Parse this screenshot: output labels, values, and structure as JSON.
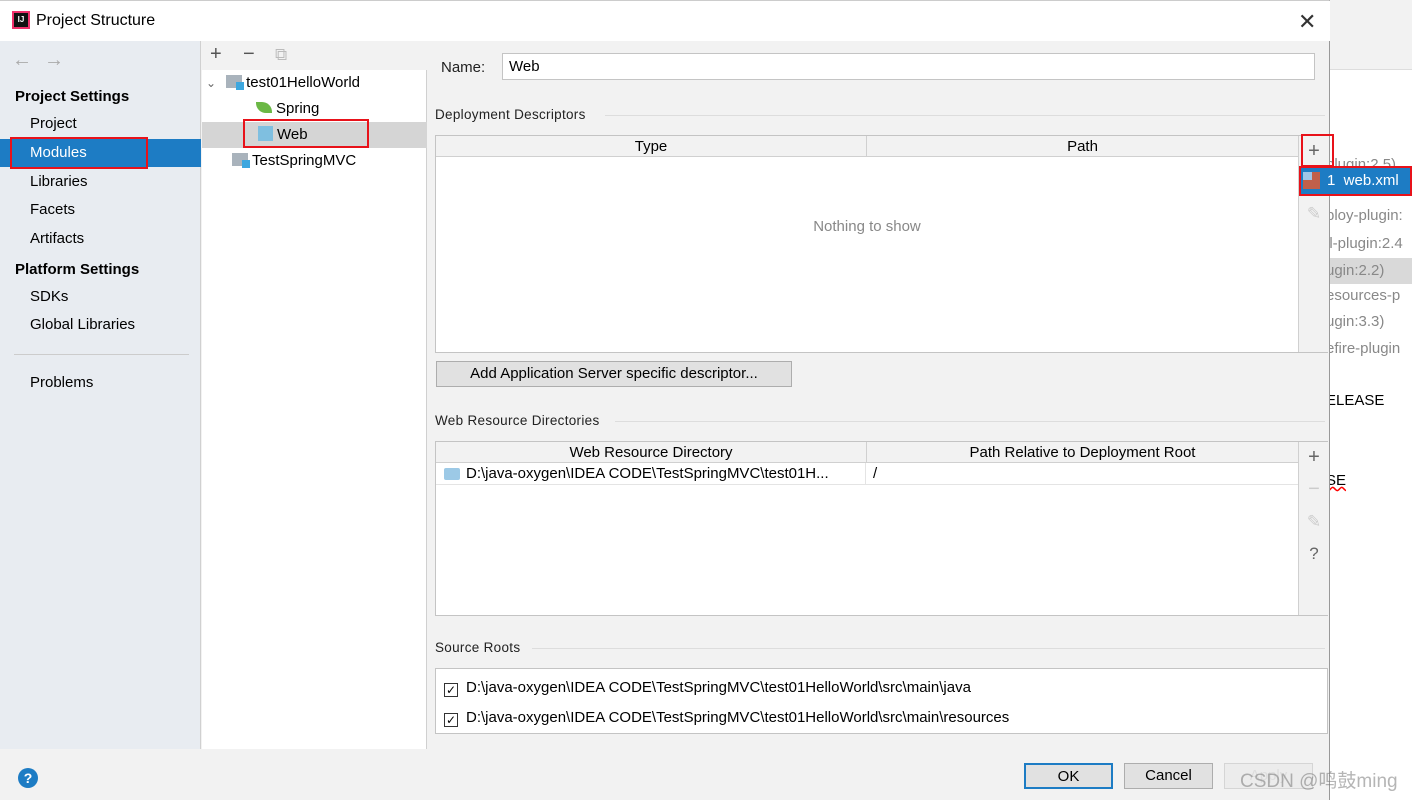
{
  "background_fragments": [
    "plugin:2.5)",
    "ploy-plugin:",
    "ll-plugin:2.4",
    "ugin:2.2)",
    "esources-p",
    "ugin:3.3)",
    "efire-plugin",
    "ELEASE",
    "SE"
  ],
  "window": {
    "title": "Project Structure",
    "close": "✕"
  },
  "nav": {
    "back": "←",
    "forward": "→"
  },
  "sidebar": {
    "project_settings": "Project Settings",
    "items": [
      {
        "label": "Project"
      },
      {
        "label": "Modules",
        "selected": true
      },
      {
        "label": "Libraries"
      },
      {
        "label": "Facets"
      },
      {
        "label": "Artifacts"
      }
    ],
    "platform_settings": "Platform Settings",
    "platform_items": [
      {
        "label": "SDKs"
      },
      {
        "label": "Global Libraries"
      }
    ],
    "problems": "Problems"
  },
  "tree": {
    "toolbar": {
      "add": "+",
      "remove": "−",
      "copy": "⧉"
    },
    "nodes": [
      {
        "label": "test01HelloWorld",
        "expanded": true
      },
      {
        "label": "Spring"
      },
      {
        "label": "Web",
        "selected": true
      },
      {
        "label": "TestSpringMVC"
      }
    ]
  },
  "main": {
    "name_label": "Name:",
    "name_value": "Web",
    "deployment_descriptors": "Deployment Descriptors",
    "dd_columns": [
      "Type",
      "Path"
    ],
    "dd_empty": "Nothing to show",
    "add_descriptor_button": "Add Application Server specific descriptor...",
    "web_resource_directories": "Web Resource Directories",
    "wr_columns": [
      "Web Resource Directory",
      "Path Relative to Deployment Root"
    ],
    "wr_rows": [
      {
        "directory": "D:\\java-oxygen\\IDEA CODE\\TestSpringMVC\\test01H...",
        "path": "/"
      }
    ],
    "source_roots": "Source Roots",
    "source_root_items": [
      {
        "path": "D:\\java-oxygen\\IDEA CODE\\TestSpringMVC\\test01HelloWorld\\src\\main\\java",
        "checked": true
      },
      {
        "path": "D:\\java-oxygen\\IDEA CODE\\TestSpringMVC\\test01HelloWorld\\src\\main\\resources",
        "checked": true
      }
    ]
  },
  "popup": {
    "item": "1  web.xml"
  },
  "footer": {
    "help": "?",
    "ok": "OK",
    "cancel": "Cancel",
    "apply": "Apply"
  },
  "watermark": "CSDN @鸣鼓ming",
  "colors": {
    "selection": "#1d7cc4",
    "highlight_box": "#e8121a"
  }
}
